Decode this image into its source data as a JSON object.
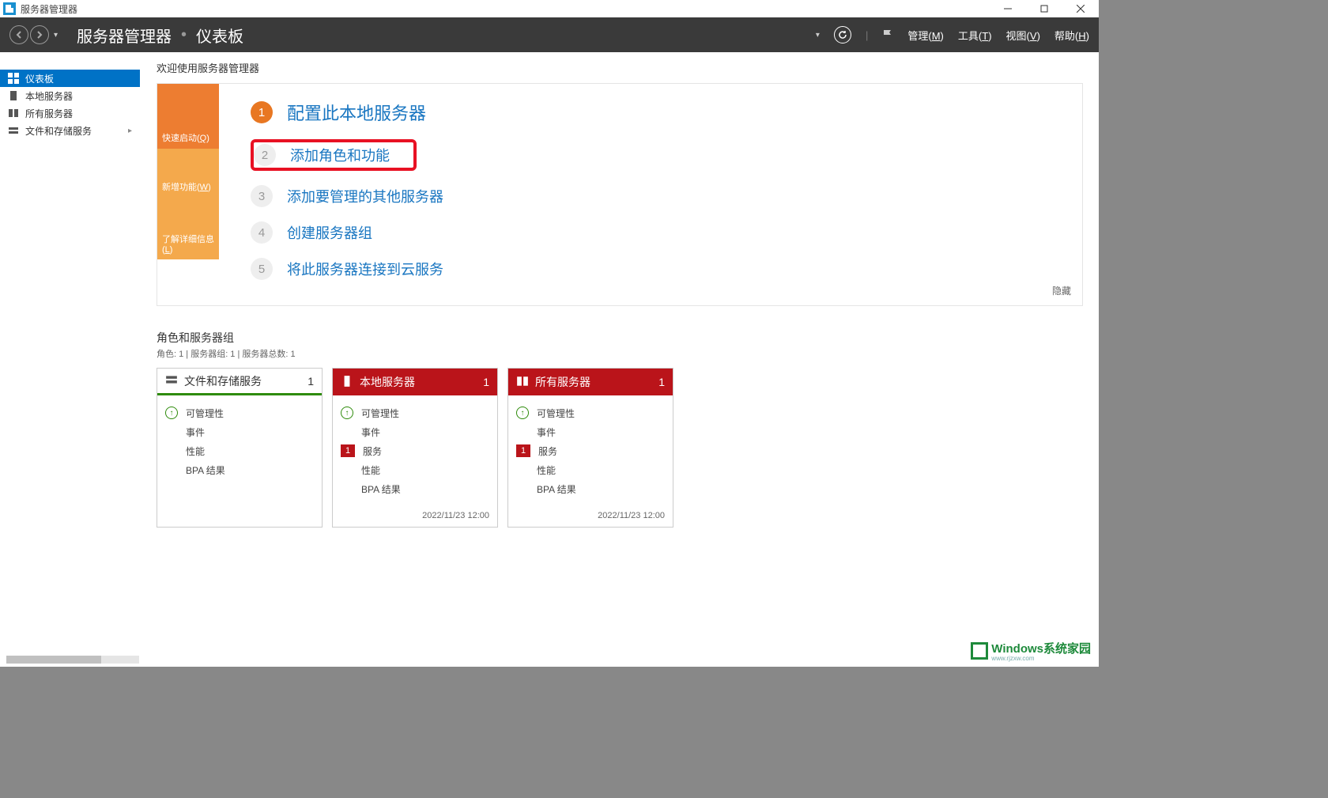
{
  "app": {
    "title": "服务器管理器"
  },
  "window_controls": {
    "min": "minimize",
    "max": "maximize",
    "close": "close"
  },
  "header": {
    "breadcrumb1": "服务器管理器",
    "breadcrumb2": "仪表板",
    "menus": {
      "manage": "管理",
      "manage_key": "M",
      "tools": "工具",
      "tools_key": "T",
      "view": "视图",
      "view_key": "V",
      "help": "帮助",
      "help_key": "H"
    }
  },
  "sidebar": {
    "items": [
      {
        "label": "仪表板",
        "icon": "dashboard",
        "active": true
      },
      {
        "label": "本地服务器",
        "icon": "server",
        "active": false
      },
      {
        "label": "所有服务器",
        "icon": "servers",
        "active": false
      },
      {
        "label": "文件和存储服务",
        "icon": "disk",
        "active": false,
        "expandable": true
      }
    ]
  },
  "welcome": {
    "title": "欢迎使用服务器管理器",
    "side_tabs": {
      "quick": {
        "prefix": "快速启动(",
        "key": "Q",
        "suffix": ")"
      },
      "new": {
        "prefix": "新增功能(",
        "key": "W",
        "suffix": ")"
      },
      "learn": {
        "prefix": "了解详细信息(",
        "key": "L",
        "suffix": ")"
      }
    },
    "steps": [
      {
        "n": "1",
        "label": "配置此本地服务器",
        "big": true
      },
      {
        "n": "2",
        "label": "添加角色和功能",
        "highlight": true
      },
      {
        "n": "3",
        "label": "添加要管理的其他服务器"
      },
      {
        "n": "4",
        "label": "创建服务器组"
      },
      {
        "n": "5",
        "label": "将此服务器连接到云服务"
      }
    ],
    "hide": "隐藏"
  },
  "roles": {
    "title": "角色和服务器组",
    "subtitle": "角色: 1 | 服务器组: 1 | 服务器总数: 1",
    "tiles": [
      {
        "title": "文件和存储服务",
        "count": "1",
        "style": "green",
        "rows": [
          {
            "icon": "up",
            "label": "可管理性"
          },
          {
            "icon": "",
            "label": "事件"
          },
          {
            "icon": "",
            "label": "性能"
          },
          {
            "icon": "",
            "label": "BPA 结果"
          }
        ],
        "footer": ""
      },
      {
        "title": "本地服务器",
        "count": "1",
        "style": "red",
        "rows": [
          {
            "icon": "up",
            "label": "可管理性"
          },
          {
            "icon": "",
            "label": "事件"
          },
          {
            "icon": "badge",
            "badge": "1",
            "label": "服务"
          },
          {
            "icon": "",
            "label": "性能"
          },
          {
            "icon": "",
            "label": "BPA 结果"
          }
        ],
        "footer": "2022/11/23 12:00"
      },
      {
        "title": "所有服务器",
        "count": "1",
        "style": "red",
        "rows": [
          {
            "icon": "up",
            "label": "可管理性"
          },
          {
            "icon": "",
            "label": "事件"
          },
          {
            "icon": "badge",
            "badge": "1",
            "label": "服务"
          },
          {
            "icon": "",
            "label": "性能"
          },
          {
            "icon": "",
            "label": "BPA 结果"
          }
        ],
        "footer": "2022/11/23 12:00"
      }
    ]
  },
  "watermark": {
    "text": "Windows系统家园",
    "sub": "www.rjzxw.com"
  }
}
